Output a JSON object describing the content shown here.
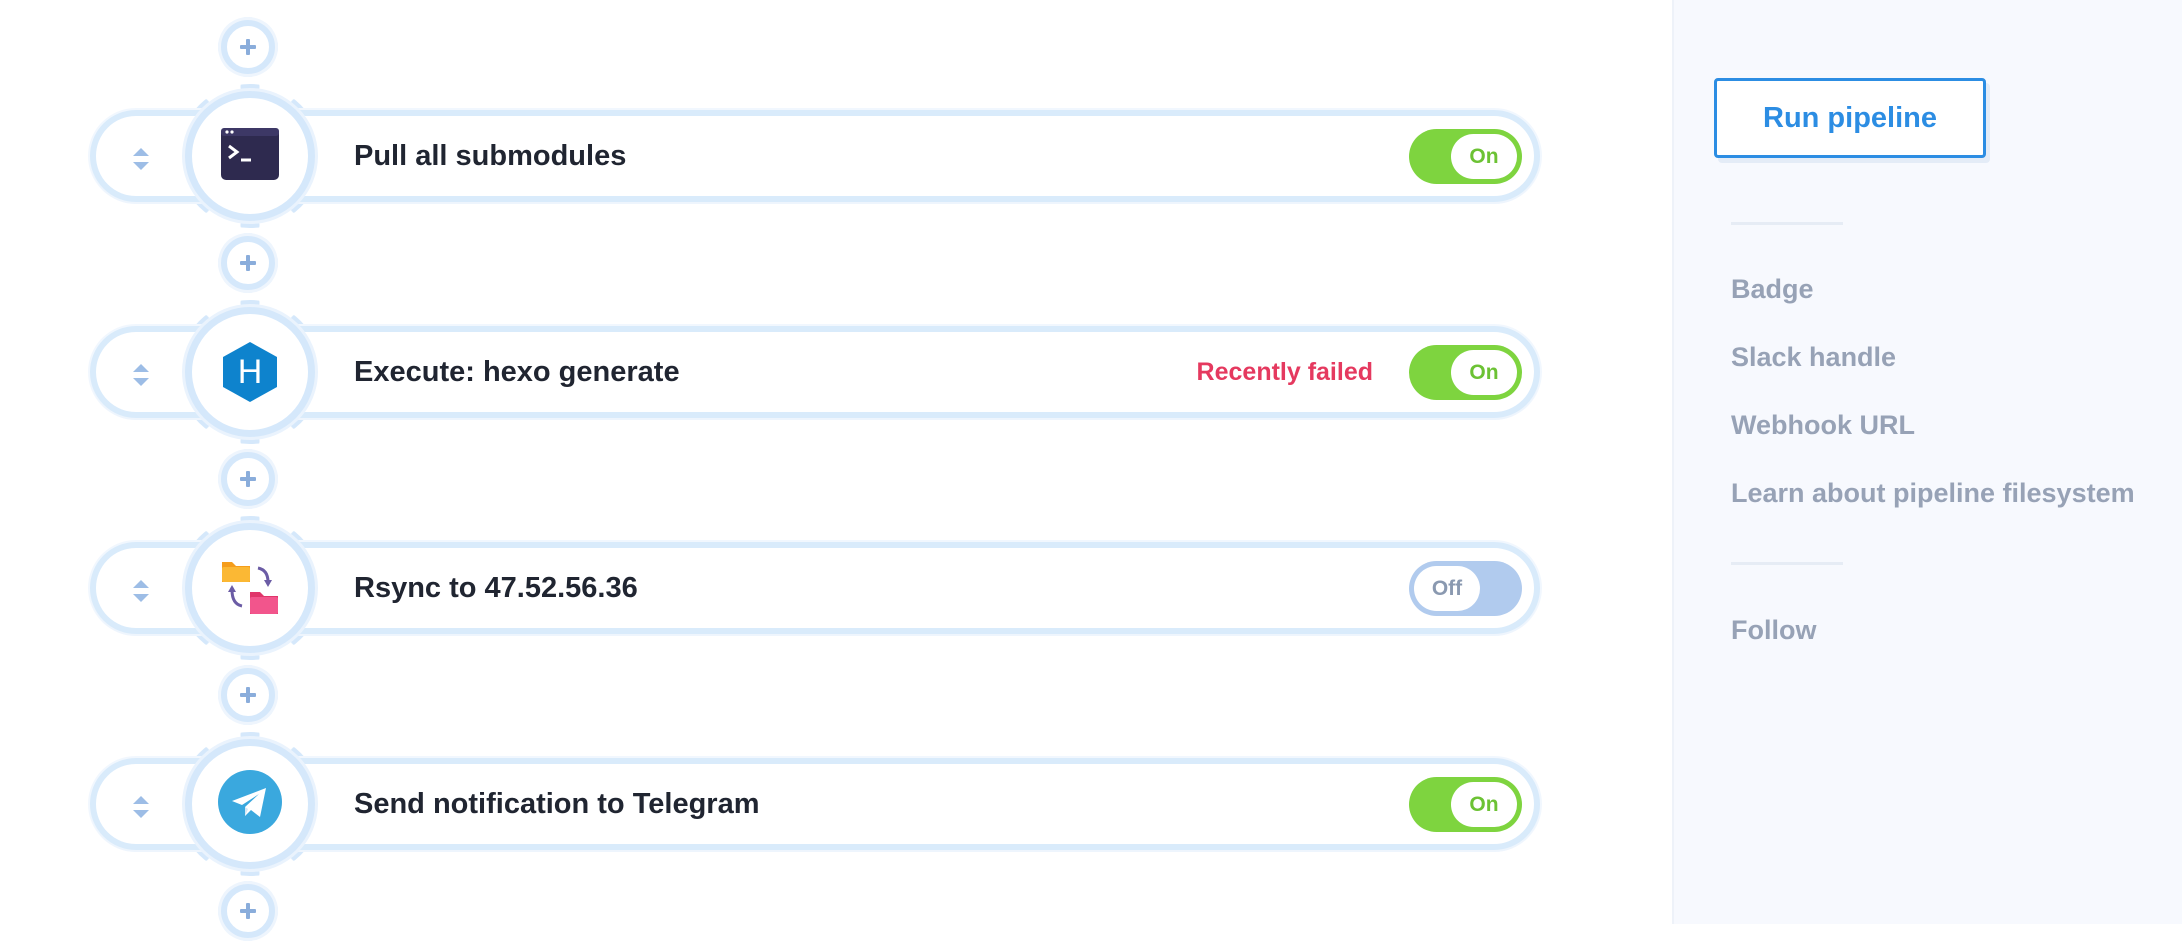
{
  "pipeline": {
    "steps": [
      {
        "name": "Pull all submodules",
        "status": "",
        "toggle": "On",
        "icon": "terminal-icon"
      },
      {
        "name": "Execute: hexo generate",
        "status": "Recently failed",
        "toggle": "On",
        "icon": "hexo-icon"
      },
      {
        "name": "Rsync to 47.52.56.36",
        "status": "",
        "toggle": "Off",
        "icon": "folder-sync-icon"
      },
      {
        "name": "Send notification to Telegram",
        "status": "",
        "toggle": "On",
        "icon": "telegram-icon"
      }
    ],
    "add_step_icon": "plus-icon",
    "drag_icon": "drag-handle-icon",
    "hexo_letter": "H"
  },
  "sidebar": {
    "run_button": "Run pipeline",
    "links": [
      "Badge",
      "Slack handle",
      "Webhook URL",
      "Learn about pipeline filesystem"
    ],
    "follow": "Follow"
  },
  "colors": {
    "toggle_on": "#7ed43f",
    "toggle_off": "#b1cbee",
    "failed": "#e5395f",
    "accent": "#2c8de3",
    "gear": "#d5e8fb"
  }
}
